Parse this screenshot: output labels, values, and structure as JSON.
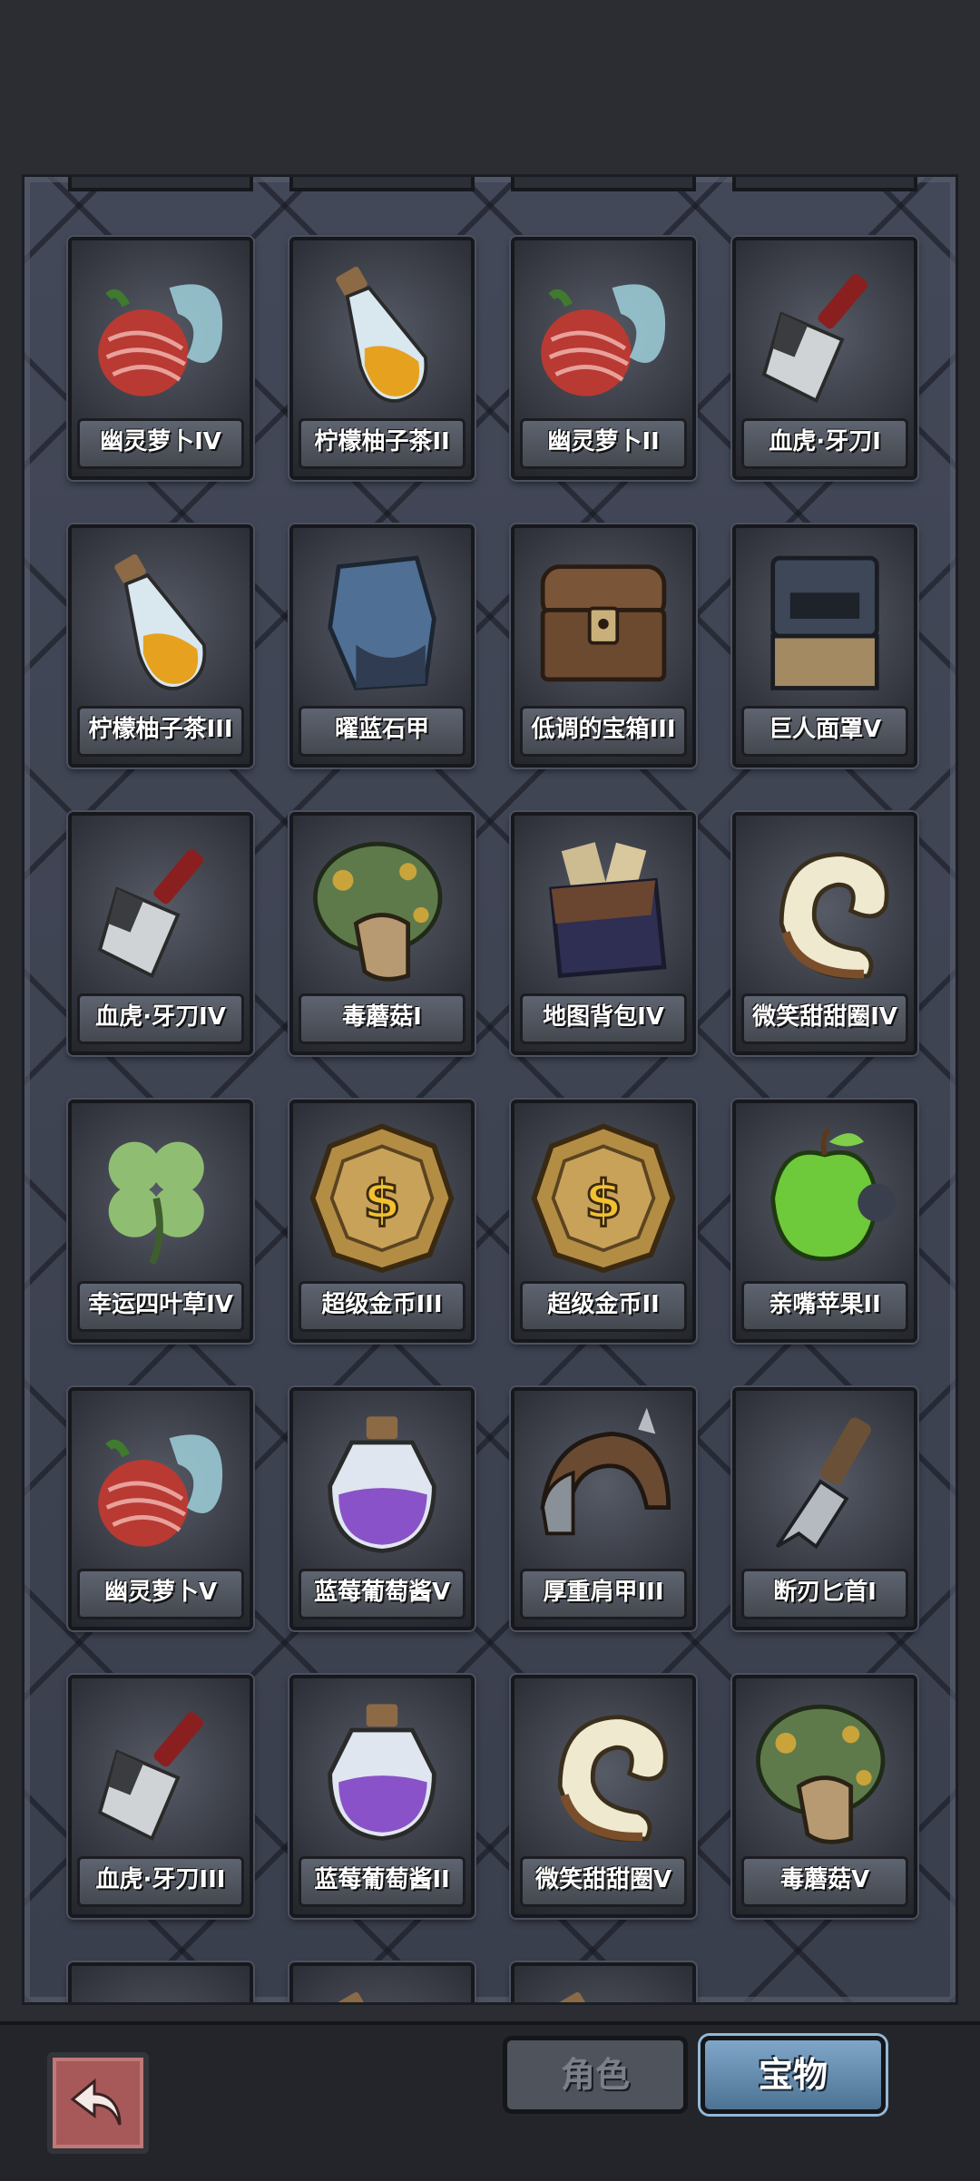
{
  "tabs": {
    "role_label": "角色",
    "treasure_label": "宝物",
    "active": "treasure"
  },
  "items": [
    {
      "name": "幽灵萝卜IV",
      "icon": "ghost-radish-icon"
    },
    {
      "name": "柠檬柚子茶II",
      "icon": "lemon-tea-potion-icon"
    },
    {
      "name": "幽灵萝卜II",
      "icon": "ghost-radish-icon"
    },
    {
      "name": "血虎·牙刀I",
      "icon": "cleaver-icon"
    },
    {
      "name": "柠檬柚子茶III",
      "icon": "lemon-tea-potion-icon"
    },
    {
      "name": "曜蓝石甲",
      "icon": "blue-stone-armor-icon"
    },
    {
      "name": "低调的宝箱III",
      "icon": "treasure-chest-icon"
    },
    {
      "name": "巨人面罩V",
      "icon": "giant-mask-icon"
    },
    {
      "name": "血虎·牙刀IV",
      "icon": "cleaver-icon"
    },
    {
      "name": "毒蘑菇I",
      "icon": "poison-mushroom-icon"
    },
    {
      "name": "地图背包IV",
      "icon": "map-backpack-icon"
    },
    {
      "name": "微笑甜甜圈IV",
      "icon": "donut-icon"
    },
    {
      "name": "幸运四叶草IV",
      "icon": "four-leaf-clover-icon"
    },
    {
      "name": "超级金币III",
      "icon": "gold-coin-icon"
    },
    {
      "name": "超级金币II",
      "icon": "gold-coin-icon"
    },
    {
      "name": "亲嘴苹果II",
      "icon": "green-apple-icon"
    },
    {
      "name": "幽灵萝卜V",
      "icon": "ghost-radish-icon"
    },
    {
      "name": "蓝莓葡萄酱V",
      "icon": "grape-jam-jar-icon"
    },
    {
      "name": "厚重肩甲III",
      "icon": "shoulder-armor-icon"
    },
    {
      "name": "断刃匕首I",
      "icon": "broken-dagger-icon"
    },
    {
      "name": "血虎·牙刀III",
      "icon": "cleaver-icon"
    },
    {
      "name": "蓝莓葡萄酱II",
      "icon": "grape-jam-jar-icon"
    },
    {
      "name": "微笑甜甜圈V",
      "icon": "donut-icon"
    },
    {
      "name": "毒蘑菇V",
      "icon": "poison-mushroom-icon"
    }
  ],
  "partial_items": [
    {
      "icon": "donut-icon"
    },
    {
      "icon": "lemon-tea-potion-icon"
    },
    {
      "icon": "lemon-tea-potion-icon"
    }
  ],
  "colors": {
    "active_tab": "#6a93b8",
    "back_button": "#a7595a"
  }
}
